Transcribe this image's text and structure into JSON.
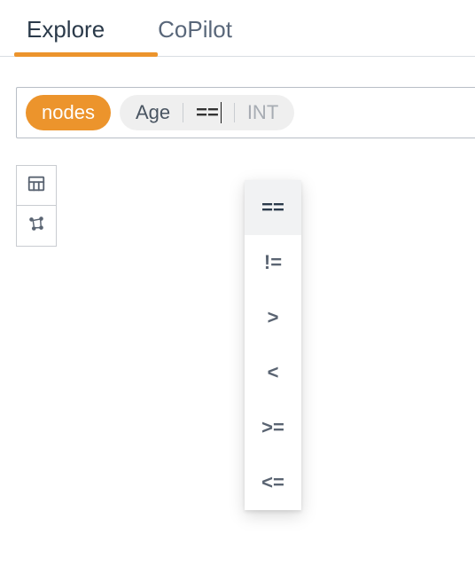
{
  "tabs": {
    "explore": "Explore",
    "copilot": "CoPilot",
    "active": "explore"
  },
  "query": {
    "entity": "nodes",
    "attribute": "Age",
    "operator": "==",
    "type_placeholder": "INT"
  },
  "operator_dropdown": {
    "options": [
      "==",
      "!=",
      ">",
      "<",
      ">=",
      "<="
    ],
    "selected": "=="
  },
  "tools": {
    "table": "table-view",
    "graph": "graph-view"
  }
}
